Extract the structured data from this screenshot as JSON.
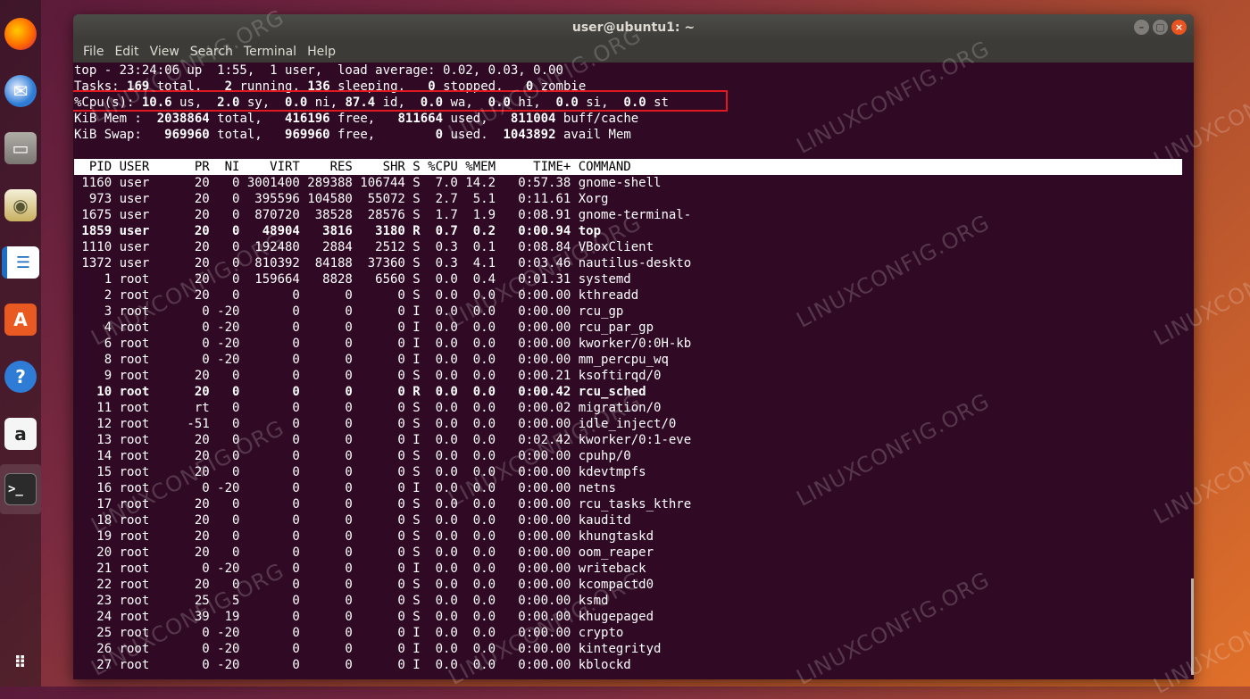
{
  "window": {
    "title": "user@ubuntu1: ~",
    "menu": [
      "File",
      "Edit",
      "View",
      "Search",
      "Terminal",
      "Help"
    ]
  },
  "dock": {
    "items": [
      "firefox-icon",
      "thunderbird-icon",
      "files-icon",
      "rhythmbox-icon",
      "writer-icon",
      "software-center-icon",
      "help-icon",
      "amazon-icon",
      "terminal-icon",
      "app-grid-icon"
    ]
  },
  "summary": {
    "line1": "top - 23:24:06 up  1:55,  1 user,  load average: 0.02, 0.03, 0.00",
    "line2": [
      "Tasks: ",
      "169",
      " total,   ",
      "2",
      " running, ",
      "136",
      " sleeping,   ",
      "0",
      " stopped,   ",
      "0",
      " zombie"
    ],
    "line3": [
      "%Cpu(s): ",
      "10.6",
      " us,  ",
      "2.0",
      " sy,  ",
      "0.0",
      " ni, ",
      "87.4",
      " id,  ",
      "0.0",
      " wa,  ",
      "0.0",
      " hi,  ",
      "0.0",
      " si,  ",
      "0.0",
      " st"
    ],
    "line4": [
      "KiB Mem :  ",
      "2038864",
      " total,   ",
      "416196",
      " free,   ",
      "811664",
      " used,   ",
      "811004",
      " buff/cache"
    ],
    "line5": [
      "KiB Swap:   ",
      "969960",
      " total,   ",
      "969960",
      " free,        ",
      "0",
      " used.  ",
      "1043892",
      " avail Mem"
    ]
  },
  "table": {
    "header": "  PID USER      PR  NI    VIRT    RES    SHR S %CPU %MEM     TIME+ COMMAND                                                      ",
    "rows": [
      {
        "text": " 1160 user      20   0 3001400 289388 106744 S  7.0 14.2   0:57.38 gnome-shell",
        "bold": false
      },
      {
        "text": "  973 user      20   0  395596 104580  55072 S  2.7  5.1   0:11.61 Xorg",
        "bold": false
      },
      {
        "text": " 1675 user      20   0  870720  38528  28576 S  1.7  1.9   0:08.91 gnome-terminal-",
        "bold": false
      },
      {
        "text": " 1859 user      20   0   48904   3816   3180 R  0.7  0.2   0:00.94 top",
        "bold": true
      },
      {
        "text": " 1110 user      20   0  192480   2884   2512 S  0.3  0.1   0:08.84 VBoxClient",
        "bold": false
      },
      {
        "text": " 1372 user      20   0  810392  84188  37360 S  0.3  4.1   0:03.46 nautilus-deskto",
        "bold": false
      },
      {
        "text": "    1 root      20   0  159664   8828   6560 S  0.0  0.4   0:01.31 systemd",
        "bold": false
      },
      {
        "text": "    2 root      20   0       0      0      0 S  0.0  0.0   0:00.00 kthreadd",
        "bold": false
      },
      {
        "text": "    3 root       0 -20       0      0      0 I  0.0  0.0   0:00.00 rcu_gp",
        "bold": false
      },
      {
        "text": "    4 root       0 -20       0      0      0 I  0.0  0.0   0:00.00 rcu_par_gp",
        "bold": false
      },
      {
        "text": "    6 root       0 -20       0      0      0 I  0.0  0.0   0:00.00 kworker/0:0H-kb",
        "bold": false
      },
      {
        "text": "    8 root       0 -20       0      0      0 I  0.0  0.0   0:00.00 mm_percpu_wq",
        "bold": false
      },
      {
        "text": "    9 root      20   0       0      0      0 S  0.0  0.0   0:00.21 ksoftirqd/0",
        "bold": false
      },
      {
        "text": "   10 root      20   0       0      0      0 R  0.0  0.0   0:00.42 rcu_sched",
        "bold": true
      },
      {
        "text": "   11 root      rt   0       0      0      0 S  0.0  0.0   0:00.02 migration/0",
        "bold": false
      },
      {
        "text": "   12 root     -51   0       0      0      0 S  0.0  0.0   0:00.00 idle_inject/0",
        "bold": false
      },
      {
        "text": "   13 root      20   0       0      0      0 I  0.0  0.0   0:02.42 kworker/0:1-eve",
        "bold": false
      },
      {
        "text": "   14 root      20   0       0      0      0 S  0.0  0.0   0:00.00 cpuhp/0",
        "bold": false
      },
      {
        "text": "   15 root      20   0       0      0      0 S  0.0  0.0   0:00.00 kdevtmpfs",
        "bold": false
      },
      {
        "text": "   16 root       0 -20       0      0      0 I  0.0  0.0   0:00.00 netns",
        "bold": false
      },
      {
        "text": "   17 root      20   0       0      0      0 S  0.0  0.0   0:00.00 rcu_tasks_kthre",
        "bold": false
      },
      {
        "text": "   18 root      20   0       0      0      0 S  0.0  0.0   0:00.00 kauditd",
        "bold": false
      },
      {
        "text": "   19 root      20   0       0      0      0 S  0.0  0.0   0:00.00 khungtaskd",
        "bold": false
      },
      {
        "text": "   20 root      20   0       0      0      0 S  0.0  0.0   0:00.00 oom_reaper",
        "bold": false
      },
      {
        "text": "   21 root       0 -20       0      0      0 I  0.0  0.0   0:00.00 writeback",
        "bold": false
      },
      {
        "text": "   22 root      20   0       0      0      0 S  0.0  0.0   0:00.00 kcompactd0",
        "bold": false
      },
      {
        "text": "   23 root      25   5       0      0      0 S  0.0  0.0   0:00.00 ksmd",
        "bold": false
      },
      {
        "text": "   24 root      39  19       0      0      0 S  0.0  0.0   0:00.00 khugepaged",
        "bold": false
      },
      {
        "text": "   25 root       0 -20       0      0      0 I  0.0  0.0   0:00.00 crypto",
        "bold": false
      },
      {
        "text": "   26 root       0 -20       0      0      0 I  0.0  0.0   0:00.00 kintegrityd",
        "bold": false
      },
      {
        "text": "   27 root       0 -20       0      0      0 I  0.0  0.0   0:00.00 kblockd",
        "bold": false
      }
    ]
  },
  "watermark": "LINUXCONFIG.ORG",
  "colors": {
    "terminal_bg": "#300a24",
    "highlight_box": "#e0191f",
    "close_button": "#e95420"
  }
}
